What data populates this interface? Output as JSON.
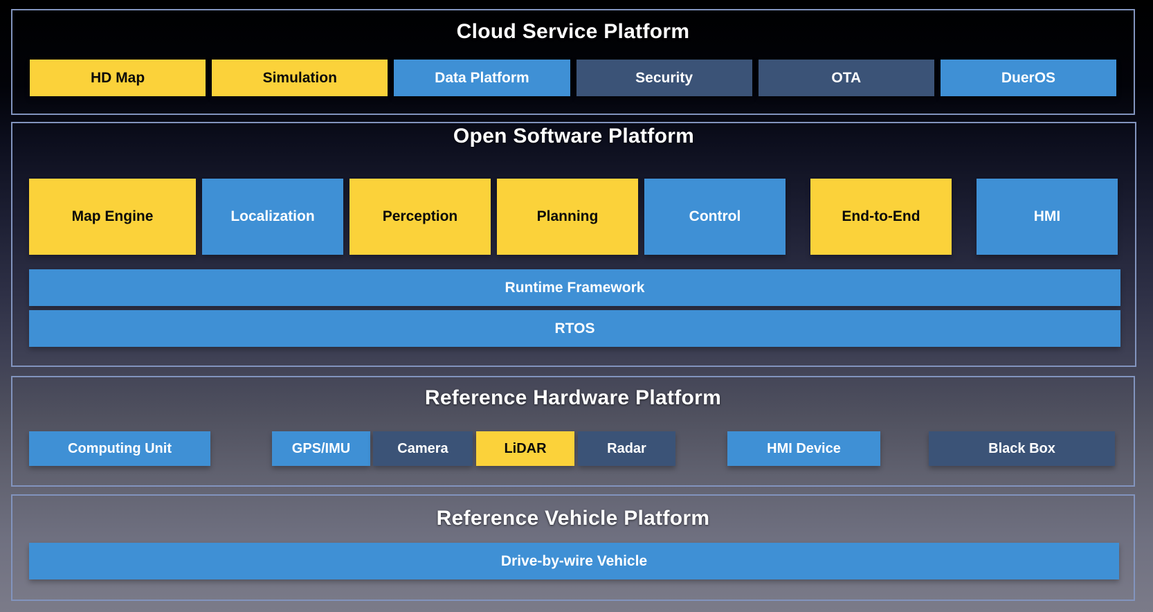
{
  "colors": {
    "yellow": "#fbd23a",
    "blue": "#3f90d5",
    "slate": "#3b5377",
    "section_border": "#8294be",
    "title_text": "#ffffff",
    "yellow_box_text": "#0a0a0a",
    "blue_box_text": "#ffffff",
    "background_top": "#000000",
    "background_bottom": "#7b7b89"
  },
  "sections": {
    "cloud": {
      "title": "Cloud Service Platform",
      "items": [
        {
          "label": "HD Map",
          "variant": "yellow"
        },
        {
          "label": "Simulation",
          "variant": "yellow"
        },
        {
          "label": "Data Platform",
          "variant": "blue"
        },
        {
          "label": "Security",
          "variant": "slate"
        },
        {
          "label": "OTA",
          "variant": "slate"
        },
        {
          "label": "DuerOS",
          "variant": "blue"
        }
      ]
    },
    "software": {
      "title": "Open Software Platform",
      "modules": [
        {
          "label": "Map Engine",
          "variant": "yellow"
        },
        {
          "label": "Localization",
          "variant": "blue"
        },
        {
          "label": "Perception",
          "variant": "yellow"
        },
        {
          "label": "Planning",
          "variant": "yellow"
        },
        {
          "label": "Control",
          "variant": "blue"
        },
        {
          "label": "End-to-End",
          "variant": "yellow"
        },
        {
          "label": "HMI",
          "variant": "blue"
        }
      ],
      "bars": [
        {
          "label": "Runtime Framework",
          "variant": "blue"
        },
        {
          "label": "RTOS",
          "variant": "blue"
        }
      ]
    },
    "hardware": {
      "title": "Reference Hardware Platform",
      "items": [
        {
          "label": "Computing Unit",
          "variant": "blue"
        },
        {
          "label": "GPS/IMU",
          "variant": "blue"
        },
        {
          "label": "Camera",
          "variant": "slate"
        },
        {
          "label": "LiDAR",
          "variant": "yellow"
        },
        {
          "label": "Radar",
          "variant": "slate"
        },
        {
          "label": "HMI Device",
          "variant": "blue"
        },
        {
          "label": "Black Box",
          "variant": "slate"
        }
      ]
    },
    "vehicle": {
      "title": "Reference Vehicle Platform",
      "bar": {
        "label": "Drive-by-wire Vehicle",
        "variant": "blue"
      }
    }
  }
}
